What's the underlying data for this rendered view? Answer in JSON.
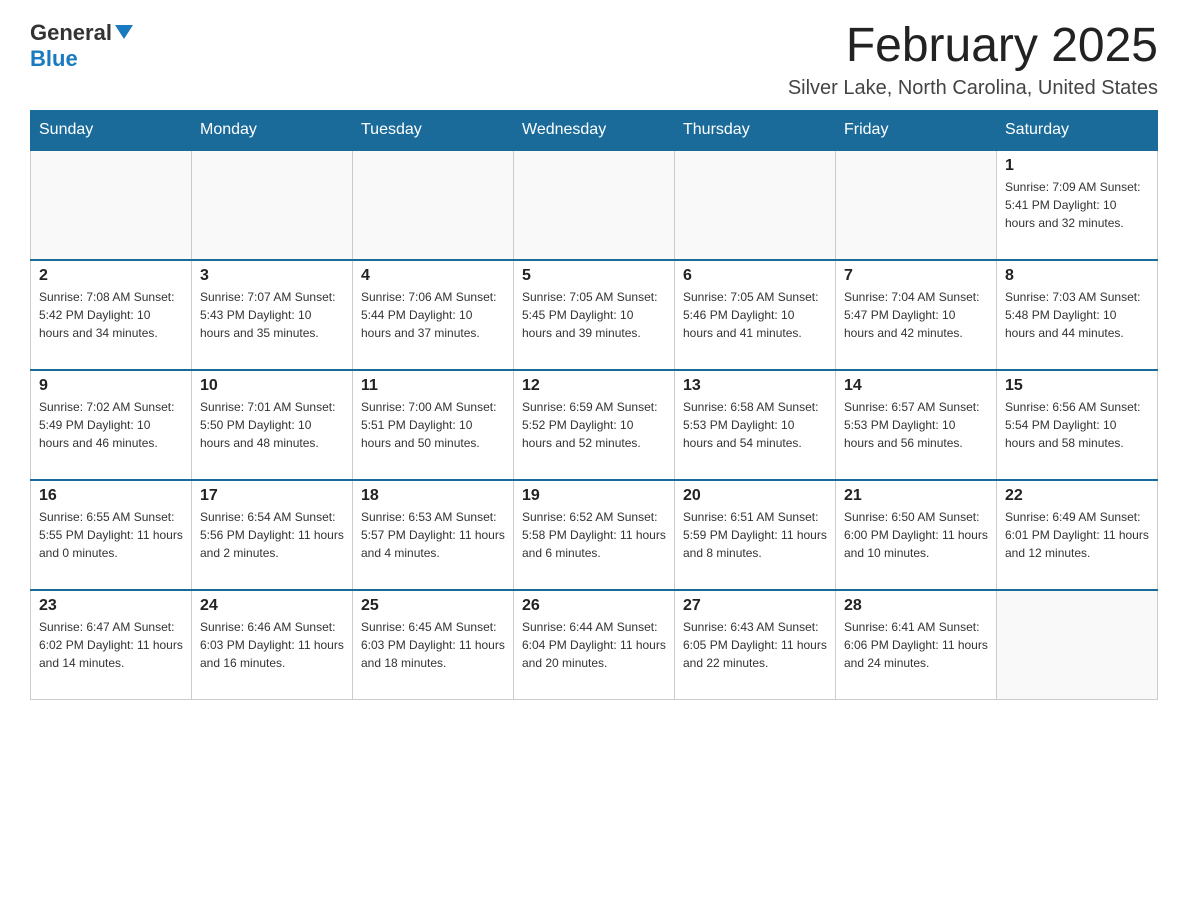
{
  "logo": {
    "general": "General",
    "blue": "Blue"
  },
  "title": "February 2025",
  "location": "Silver Lake, North Carolina, United States",
  "weekdays": [
    "Sunday",
    "Monday",
    "Tuesday",
    "Wednesday",
    "Thursday",
    "Friday",
    "Saturday"
  ],
  "weeks": [
    [
      {
        "day": "",
        "info": ""
      },
      {
        "day": "",
        "info": ""
      },
      {
        "day": "",
        "info": ""
      },
      {
        "day": "",
        "info": ""
      },
      {
        "day": "",
        "info": ""
      },
      {
        "day": "",
        "info": ""
      },
      {
        "day": "1",
        "info": "Sunrise: 7:09 AM\nSunset: 5:41 PM\nDaylight: 10 hours\nand 32 minutes."
      }
    ],
    [
      {
        "day": "2",
        "info": "Sunrise: 7:08 AM\nSunset: 5:42 PM\nDaylight: 10 hours\nand 34 minutes."
      },
      {
        "day": "3",
        "info": "Sunrise: 7:07 AM\nSunset: 5:43 PM\nDaylight: 10 hours\nand 35 minutes."
      },
      {
        "day": "4",
        "info": "Sunrise: 7:06 AM\nSunset: 5:44 PM\nDaylight: 10 hours\nand 37 minutes."
      },
      {
        "day": "5",
        "info": "Sunrise: 7:05 AM\nSunset: 5:45 PM\nDaylight: 10 hours\nand 39 minutes."
      },
      {
        "day": "6",
        "info": "Sunrise: 7:05 AM\nSunset: 5:46 PM\nDaylight: 10 hours\nand 41 minutes."
      },
      {
        "day": "7",
        "info": "Sunrise: 7:04 AM\nSunset: 5:47 PM\nDaylight: 10 hours\nand 42 minutes."
      },
      {
        "day": "8",
        "info": "Sunrise: 7:03 AM\nSunset: 5:48 PM\nDaylight: 10 hours\nand 44 minutes."
      }
    ],
    [
      {
        "day": "9",
        "info": "Sunrise: 7:02 AM\nSunset: 5:49 PM\nDaylight: 10 hours\nand 46 minutes."
      },
      {
        "day": "10",
        "info": "Sunrise: 7:01 AM\nSunset: 5:50 PM\nDaylight: 10 hours\nand 48 minutes."
      },
      {
        "day": "11",
        "info": "Sunrise: 7:00 AM\nSunset: 5:51 PM\nDaylight: 10 hours\nand 50 minutes."
      },
      {
        "day": "12",
        "info": "Sunrise: 6:59 AM\nSunset: 5:52 PM\nDaylight: 10 hours\nand 52 minutes."
      },
      {
        "day": "13",
        "info": "Sunrise: 6:58 AM\nSunset: 5:53 PM\nDaylight: 10 hours\nand 54 minutes."
      },
      {
        "day": "14",
        "info": "Sunrise: 6:57 AM\nSunset: 5:53 PM\nDaylight: 10 hours\nand 56 minutes."
      },
      {
        "day": "15",
        "info": "Sunrise: 6:56 AM\nSunset: 5:54 PM\nDaylight: 10 hours\nand 58 minutes."
      }
    ],
    [
      {
        "day": "16",
        "info": "Sunrise: 6:55 AM\nSunset: 5:55 PM\nDaylight: 11 hours\nand 0 minutes."
      },
      {
        "day": "17",
        "info": "Sunrise: 6:54 AM\nSunset: 5:56 PM\nDaylight: 11 hours\nand 2 minutes."
      },
      {
        "day": "18",
        "info": "Sunrise: 6:53 AM\nSunset: 5:57 PM\nDaylight: 11 hours\nand 4 minutes."
      },
      {
        "day": "19",
        "info": "Sunrise: 6:52 AM\nSunset: 5:58 PM\nDaylight: 11 hours\nand 6 minutes."
      },
      {
        "day": "20",
        "info": "Sunrise: 6:51 AM\nSunset: 5:59 PM\nDaylight: 11 hours\nand 8 minutes."
      },
      {
        "day": "21",
        "info": "Sunrise: 6:50 AM\nSunset: 6:00 PM\nDaylight: 11 hours\nand 10 minutes."
      },
      {
        "day": "22",
        "info": "Sunrise: 6:49 AM\nSunset: 6:01 PM\nDaylight: 11 hours\nand 12 minutes."
      }
    ],
    [
      {
        "day": "23",
        "info": "Sunrise: 6:47 AM\nSunset: 6:02 PM\nDaylight: 11 hours\nand 14 minutes."
      },
      {
        "day": "24",
        "info": "Sunrise: 6:46 AM\nSunset: 6:03 PM\nDaylight: 11 hours\nand 16 minutes."
      },
      {
        "day": "25",
        "info": "Sunrise: 6:45 AM\nSunset: 6:03 PM\nDaylight: 11 hours\nand 18 minutes."
      },
      {
        "day": "26",
        "info": "Sunrise: 6:44 AM\nSunset: 6:04 PM\nDaylight: 11 hours\nand 20 minutes."
      },
      {
        "day": "27",
        "info": "Sunrise: 6:43 AM\nSunset: 6:05 PM\nDaylight: 11 hours\nand 22 minutes."
      },
      {
        "day": "28",
        "info": "Sunrise: 6:41 AM\nSunset: 6:06 PM\nDaylight: 11 hours\nand 24 minutes."
      },
      {
        "day": "",
        "info": ""
      }
    ]
  ]
}
